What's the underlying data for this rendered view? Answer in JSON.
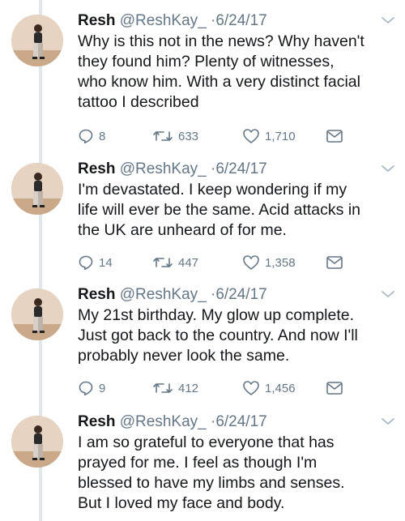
{
  "tweets": [
    {
      "name": "Resh",
      "handle": "@ReshKay_",
      "separator": "·",
      "date": "6/24/17",
      "lines": [
        "Why is this not in the news? Why haven't",
        "they found him? Plenty of witnesses,",
        "who know him. With a very distinct facial",
        "tattoo I described"
      ],
      "replies": "8",
      "retweets": "633",
      "likes": "1,710"
    },
    {
      "name": "Resh",
      "handle": "@ReshKay_",
      "separator": "·",
      "date": "6/24/17",
      "lines": [
        "I'm devastated. I keep wondering if my",
        "life will ever be the same. Acid attacks in",
        "the UK are unheard of for me."
      ],
      "replies": "14",
      "retweets": "447",
      "likes": "1,358"
    },
    {
      "name": "Resh",
      "handle": "@ReshKay_",
      "separator": "·",
      "date": "6/24/17",
      "lines": [
        "My 21st birthday. My glow up complete.",
        "Just got back to the country. And now I'll",
        "probably never look the same."
      ],
      "replies": "9",
      "retweets": "412",
      "likes": "1,456"
    },
    {
      "name": "Resh",
      "handle": "@ReshKay_",
      "separator": "·",
      "date": "6/24/17",
      "lines": [
        "I am so grateful to everyone that has",
        "prayed for me. I feel as though I'm",
        "blessed to have my limbs and senses.",
        "But I loved my face and body."
      ]
    }
  ],
  "colors": {
    "text": "#14171a",
    "muted": "#657786",
    "thread_line": "#e1e8ed"
  },
  "icons": [
    "reply-icon",
    "retweet-icon",
    "like-icon",
    "message-icon",
    "chevron-down-icon"
  ]
}
